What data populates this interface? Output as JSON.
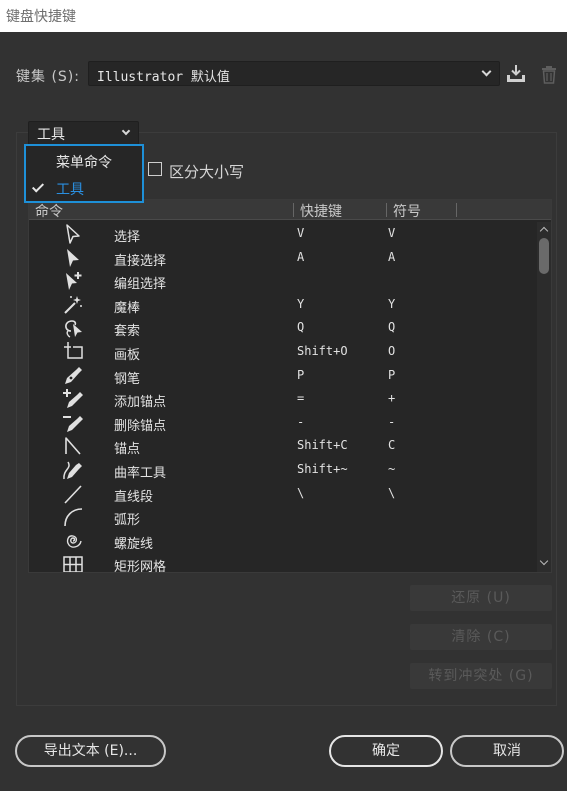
{
  "window": {
    "title": "键盘快捷键"
  },
  "keyset": {
    "label": "键集 (S):",
    "value": "Illustrator 默认值"
  },
  "toolset": {
    "value": "工具",
    "options": [
      {
        "label": "菜单命令",
        "checked": false
      },
      {
        "label": "工具",
        "checked": true
      }
    ]
  },
  "case_sensitive": {
    "label": "区分大小写",
    "checked": false
  },
  "table": {
    "columns": [
      "命令",
      "快捷键",
      "符号"
    ],
    "rows": [
      {
        "icon": "selection-tool-icon",
        "name": "选择",
        "shortcut": "V",
        "symbol": "V"
      },
      {
        "icon": "direct-selection-tool-icon",
        "name": "直接选择",
        "shortcut": "A",
        "symbol": "A"
      },
      {
        "icon": "group-selection-tool-icon",
        "name": "编组选择",
        "shortcut": "",
        "symbol": ""
      },
      {
        "icon": "magic-wand-tool-icon",
        "name": "魔棒",
        "shortcut": "Y",
        "symbol": "Y"
      },
      {
        "icon": "lasso-tool-icon",
        "name": "套索",
        "shortcut": "Q",
        "symbol": "Q"
      },
      {
        "icon": "artboard-tool-icon",
        "name": "画板",
        "shortcut": "Shift+O",
        "symbol": "O"
      },
      {
        "icon": "pen-tool-icon",
        "name": "钢笔",
        "shortcut": "P",
        "symbol": "P"
      },
      {
        "icon": "add-anchor-point-tool-icon",
        "name": "添加锚点",
        "shortcut": "=",
        "symbol": "+"
      },
      {
        "icon": "delete-anchor-point-tool-icon",
        "name": "删除锚点",
        "shortcut": "-",
        "symbol": "-"
      },
      {
        "icon": "anchor-point-tool-icon",
        "name": "锚点",
        "shortcut": "Shift+C",
        "symbol": "C"
      },
      {
        "icon": "curvature-tool-icon",
        "name": "曲率工具",
        "shortcut": "Shift+~",
        "symbol": "~"
      },
      {
        "icon": "line-segment-tool-icon",
        "name": "直线段",
        "shortcut": "\\",
        "symbol": "\\"
      },
      {
        "icon": "arc-tool-icon",
        "name": "弧形",
        "shortcut": "",
        "symbol": ""
      },
      {
        "icon": "spiral-tool-icon",
        "name": "螺旋线",
        "shortcut": "",
        "symbol": ""
      },
      {
        "icon": "rectangular-grid-tool-icon",
        "name": "矩形网格",
        "shortcut": "",
        "symbol": ""
      }
    ]
  },
  "buttons": {
    "undo": "还原 (U)",
    "clear": "清除 (C)",
    "goto_conflict": "转到冲突处 (G)",
    "export_text": "导出文本 (E)...",
    "ok": "确定",
    "cancel": "取消"
  }
}
